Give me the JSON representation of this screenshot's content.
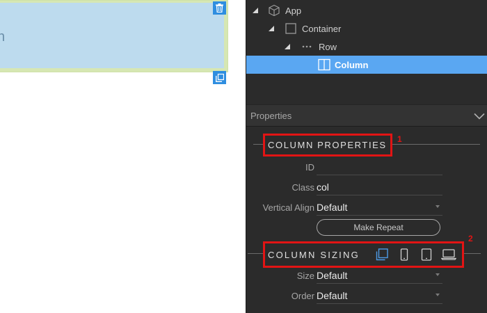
{
  "canvas": {
    "column_text": "n"
  },
  "tree": {
    "items": [
      {
        "label": "App",
        "icon": "cube-icon"
      },
      {
        "label": "Container",
        "icon": "square-icon"
      },
      {
        "label": "Row",
        "icon": "dots-icon"
      },
      {
        "label": "Column",
        "icon": "column-icon",
        "selected": true
      }
    ]
  },
  "properties": {
    "title": "Properties",
    "column_properties": {
      "heading": "COLUMN PROPERTIES",
      "callout": "1",
      "fields": {
        "id_label": "ID",
        "id_value": "",
        "class_label": "Class",
        "class_value": "col",
        "valign_label": "Vertical Align",
        "valign_value": "Default"
      },
      "make_repeat_label": "Make Repeat"
    },
    "column_sizing": {
      "heading": "COLUMN SIZING",
      "callout": "2",
      "device_icons": [
        "all-devices-icon",
        "phone-icon",
        "tablet-icon",
        "laptop-icon"
      ],
      "active_device": "all-devices-icon",
      "fields": {
        "size_label": "Size",
        "size_value": "Default",
        "order_label": "Order",
        "order_value": "Default"
      }
    }
  },
  "colors": {
    "selection": "#5aa7f2",
    "highlight_box": "#e21414",
    "active_icon": "#4d9be6",
    "column_fill": "#bddbee"
  }
}
